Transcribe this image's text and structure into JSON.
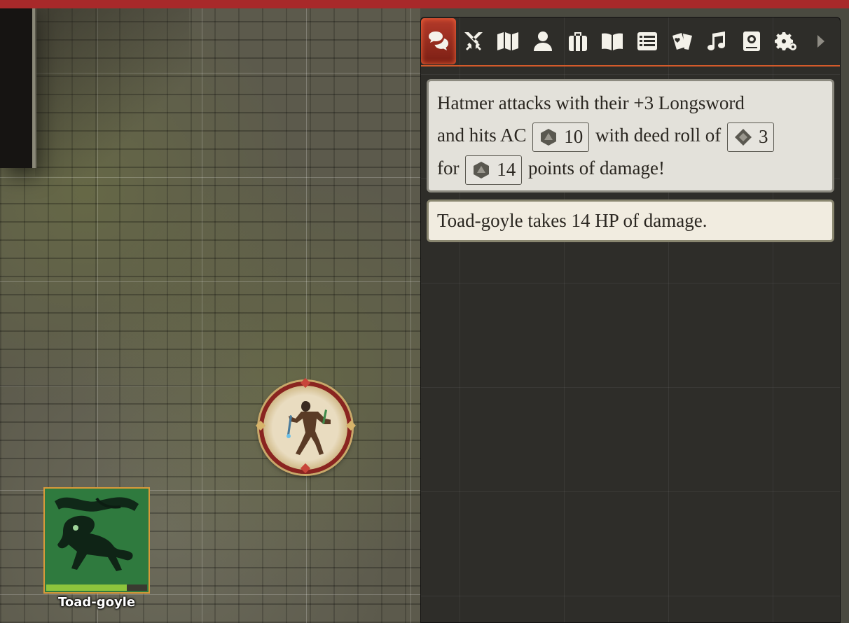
{
  "chat": {
    "messages": [
      {
        "seg1": "Hatmer attacks with their +3 Longsword",
        "seg2": "and hits AC",
        "roll_ac": "10",
        "seg3": "with deed roll of",
        "roll_deed": "3",
        "seg4": "for",
        "roll_damage": "14",
        "seg5": "points of damage!"
      },
      {
        "text": "Toad-goyle takes 14 HP of damage."
      }
    ]
  },
  "sidebar": {
    "tabs": [
      {
        "icon": "chat-icon",
        "active": true
      },
      {
        "icon": "crossed-swords-icon"
      },
      {
        "icon": "map-icon"
      },
      {
        "icon": "user-icon"
      },
      {
        "icon": "suitcase-icon"
      },
      {
        "icon": "book-icon"
      },
      {
        "icon": "list-icon"
      },
      {
        "icon": "cards-icon"
      },
      {
        "icon": "music-icon"
      },
      {
        "icon": "compendium-icon"
      },
      {
        "icon": "settings-icon"
      },
      {
        "icon": "chevron-right-icon"
      }
    ]
  },
  "tokens": {
    "toad": {
      "name": "Toad-goyle",
      "hp_fraction": 0.8
    }
  },
  "colors": {
    "top_bar": "#a8292a",
    "active_tab": "#b43a2a",
    "hp_bar": "#8ec43c",
    "tab_underline": "#d35a2a"
  }
}
